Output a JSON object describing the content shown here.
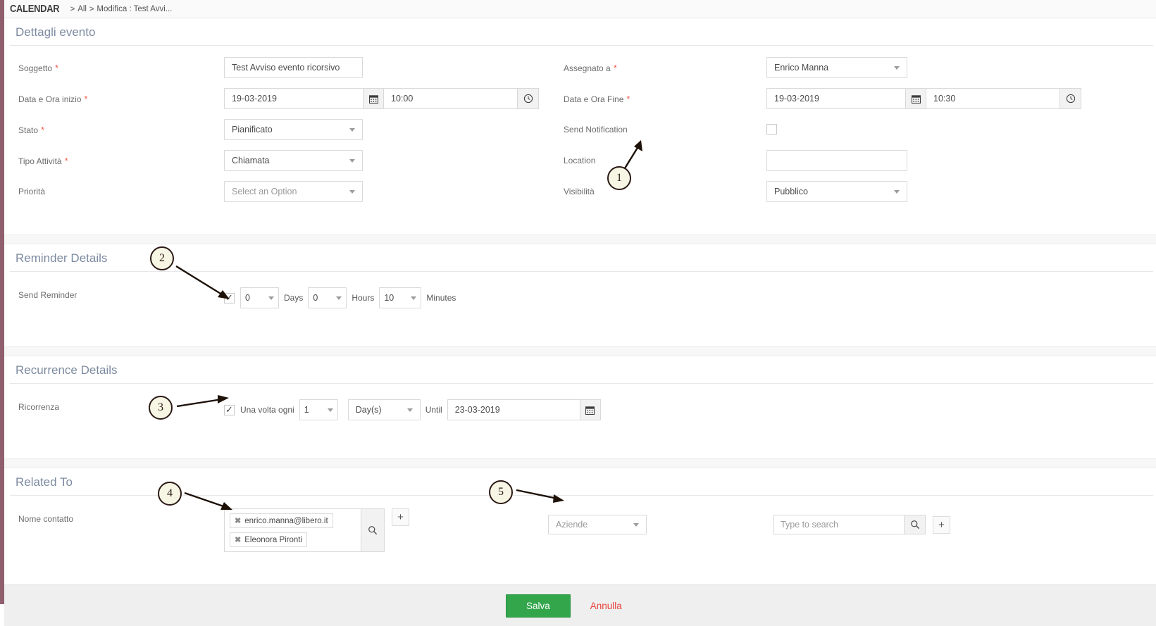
{
  "breadcrumb": {
    "module": "CALENDAR",
    "sep": ">",
    "all": "All",
    "current": "Modifica : Test Avvi..."
  },
  "sections": {
    "event_details": "Dettagli evento",
    "reminder_details": "Reminder Details",
    "recurrence_details": "Recurrence Details",
    "related_to": "Related To"
  },
  "event": {
    "subject": {
      "label": "Soggetto",
      "value": "Test Avviso evento ricorsivo",
      "required": true
    },
    "start": {
      "label": "Data e Ora inizio",
      "date": "19-03-2019",
      "time": "10:00",
      "required": true
    },
    "status": {
      "label": "Stato",
      "value": "Pianificato",
      "required": true
    },
    "activity_type": {
      "label": "Tipo Attività",
      "value": "Chiamata",
      "required": true
    },
    "priority": {
      "label": "Priorità",
      "value": "Select an Option",
      "required": false
    },
    "assigned_to": {
      "label": "Assegnato a",
      "value": "Enrico Manna",
      "required": true
    },
    "end": {
      "label": "Data e Ora Fine",
      "date": "19-03-2019",
      "time": "10:30",
      "required": true
    },
    "send_notification": {
      "label": "Send Notification",
      "checked": false
    },
    "location": {
      "label": "Location",
      "value": ""
    },
    "visibility": {
      "label": "Visibilità",
      "value": "Pubblico"
    }
  },
  "reminder": {
    "label": "Send Reminder",
    "checked": true,
    "days_value": "0",
    "days_label": "Days",
    "hours_value": "0",
    "hours_label": "Hours",
    "minutes_value": "10",
    "minutes_label": "Minutes"
  },
  "recurrence": {
    "label": "Ricorrenza",
    "checked": true,
    "every_label": "Una volta ogni",
    "interval_value": "1",
    "unit_value": "Day(s)",
    "until_label": "Until",
    "until_date": "23-03-2019"
  },
  "related": {
    "contact_label": "Nome contatto",
    "tokens": [
      "enrico.manna@libero.it",
      "Eleonora Pironti"
    ],
    "token_remove": "✖",
    "add_label": "+",
    "module_select": "Aziende",
    "search_placeholder": "Type to search"
  },
  "footer": {
    "save": "Salva",
    "cancel": "Annulla"
  },
  "annotations": [
    {
      "number": "1"
    },
    {
      "number": "2"
    },
    {
      "number": "3"
    },
    {
      "number": "4"
    },
    {
      "number": "5"
    }
  ],
  "colors": {
    "accent_stripe": "#8f5f6e",
    "save_green": "#33a64c",
    "cancel_red": "#e8453c",
    "required_red": "#f05b4f",
    "section_heading": "#7d8ba0"
  }
}
